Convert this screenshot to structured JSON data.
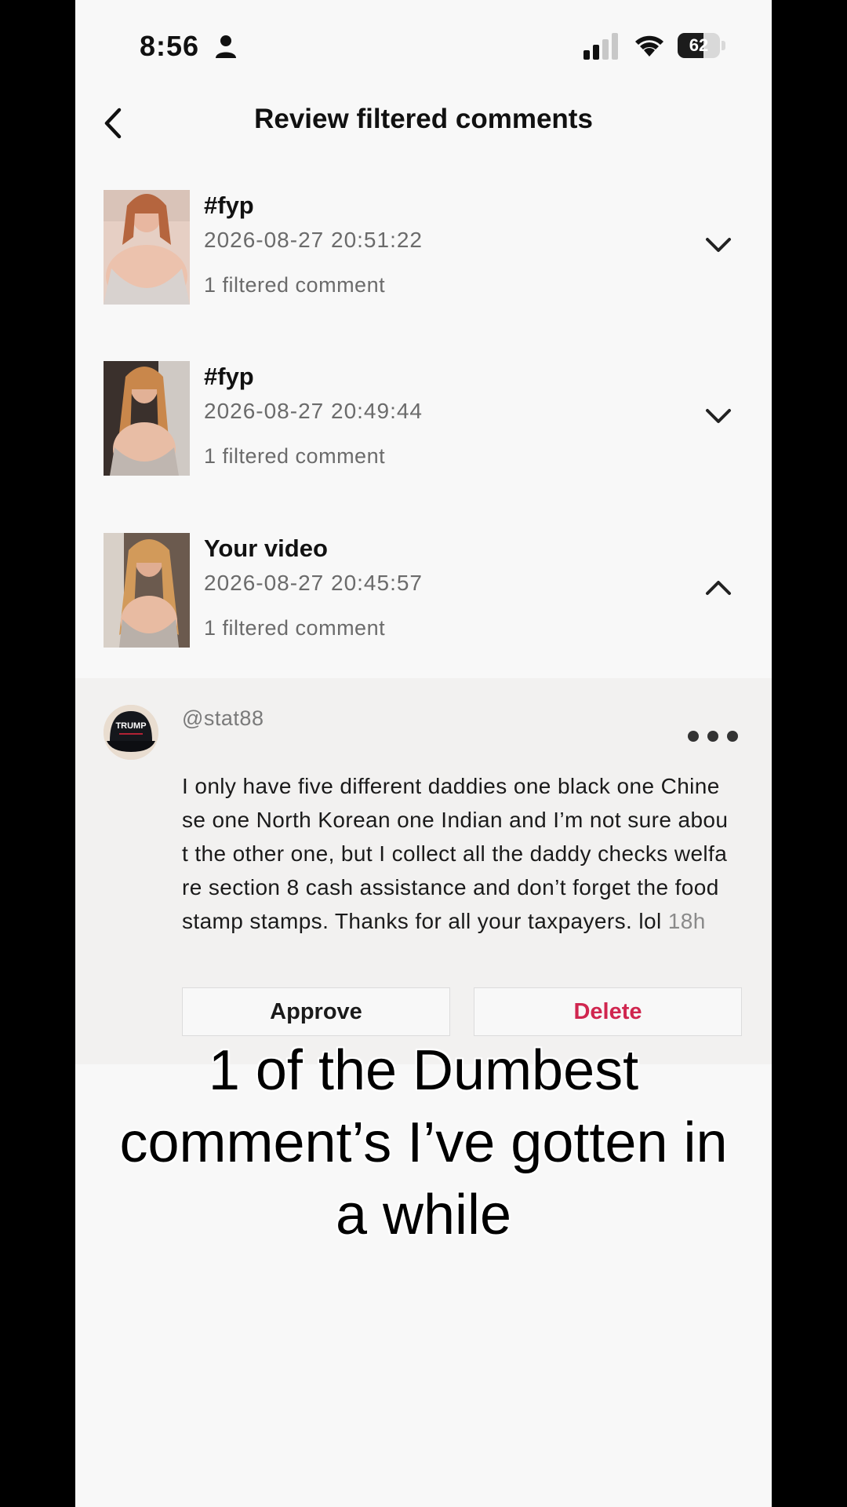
{
  "status_bar": {
    "time": "8:56",
    "battery": "62",
    "battery_fraction": 0.62,
    "icons": [
      "person-icon",
      "signal-icon",
      "wifi-icon",
      "battery-icon"
    ]
  },
  "header": {
    "title": "Review filtered comments",
    "back_icon": "chevron-left-icon"
  },
  "videos": [
    {
      "title": "#fyp",
      "date": "2026-08-27 20:51:22",
      "count": "1 filtered comment",
      "expanded": false
    },
    {
      "title": "#fyp",
      "date": "2026-08-27 20:49:44",
      "count": "1 filtered comment",
      "expanded": false
    },
    {
      "title": "Your video",
      "date": "2026-08-27 20:45:57",
      "count": "1 filtered comment",
      "expanded": true
    }
  ],
  "comment": {
    "handle": "@stat88",
    "text": "I only have five different daddies one black one Chinese one North Korean one Indian and I’m not sure about the other one, but I collect all the daddy checks welfare section 8 cash assistance and don’t forget the food stamp stamps. Thanks for all your taxpayers. lol",
    "time": "18h",
    "avatar_text": "TRUMP",
    "approve_label": "Approve",
    "delete_label": "Delete"
  },
  "caption": {
    "line1": "1 of the Dumbest",
    "line2": "comment’s I’ve gotten in",
    "line3": "a while"
  },
  "colors": {
    "delete": "#d0264f",
    "muted_text": "#6b6b6b",
    "background": "#f8f8f8"
  }
}
